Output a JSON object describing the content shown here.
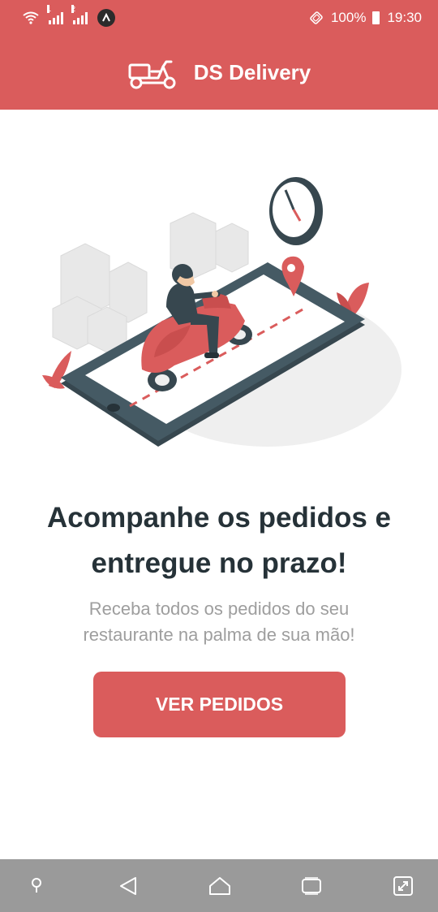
{
  "status_bar": {
    "signal_1_label": "1",
    "signal_2_label": "2",
    "battery": "100%",
    "time": "19:30",
    "icons": [
      "wifi-icon",
      "signal-icon",
      "signal-icon",
      "app-notification-icon",
      "vibrate-icon",
      "battery-icon"
    ]
  },
  "header": {
    "title": "DS Delivery",
    "logo_icon": "scooter-icon"
  },
  "hero": {
    "headline_line1": "Acompanhe os pedidos e",
    "headline_line2": "entregue no prazo!",
    "subtext_line1": "Receba todos os pedidos do seu",
    "subtext_line2": "restaurante na palma de sua mão!",
    "button_label": "VER PEDIDOS"
  },
  "nav_bar": {
    "icons": [
      "assistant-icon",
      "back-icon",
      "home-icon",
      "recents-icon",
      "screenshot-icon"
    ]
  },
  "colors": {
    "brand": "#DA5C5C",
    "headline": "#263238",
    "subtext": "#9E9E9E"
  }
}
